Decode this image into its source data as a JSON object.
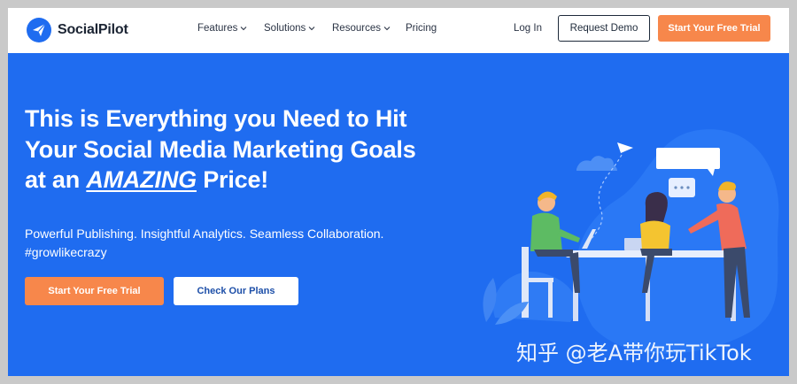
{
  "brand": {
    "name": "SocialPilot"
  },
  "nav": {
    "items": [
      {
        "label": "Features",
        "has_dropdown": true
      },
      {
        "label": "Solutions",
        "has_dropdown": true
      },
      {
        "label": "Resources",
        "has_dropdown": true
      },
      {
        "label": "Pricing",
        "has_dropdown": false
      }
    ],
    "login_label": "Log In",
    "demo_label": "Request Demo",
    "trial_label": "Start Your Free Trial"
  },
  "hero": {
    "title_line1": "This is Everything you Need to Hit",
    "title_line2": "Your Social Media Marketing Goals",
    "title_line3_pre": "at an",
    "title_line3_em": "AMAZING",
    "title_line3_post": "Price!",
    "subtitle_line1": "Powerful Publishing. Insightful Analytics. Seamless Collaboration.",
    "subtitle_line2": "#growlikecrazy",
    "cta_primary": "Start Your Free Trial",
    "cta_secondary": "Check Our Plans"
  },
  "watermark": "知乎 @老A带你玩TikTok",
  "colors": {
    "hero_bg": "#1f6cf0",
    "accent_orange": "#f7874b",
    "nav_bg": "#ffffff"
  },
  "icons": [
    "logo-paper-plane-icon",
    "chevron-down-icon",
    "team-collaboration-illustration"
  ]
}
